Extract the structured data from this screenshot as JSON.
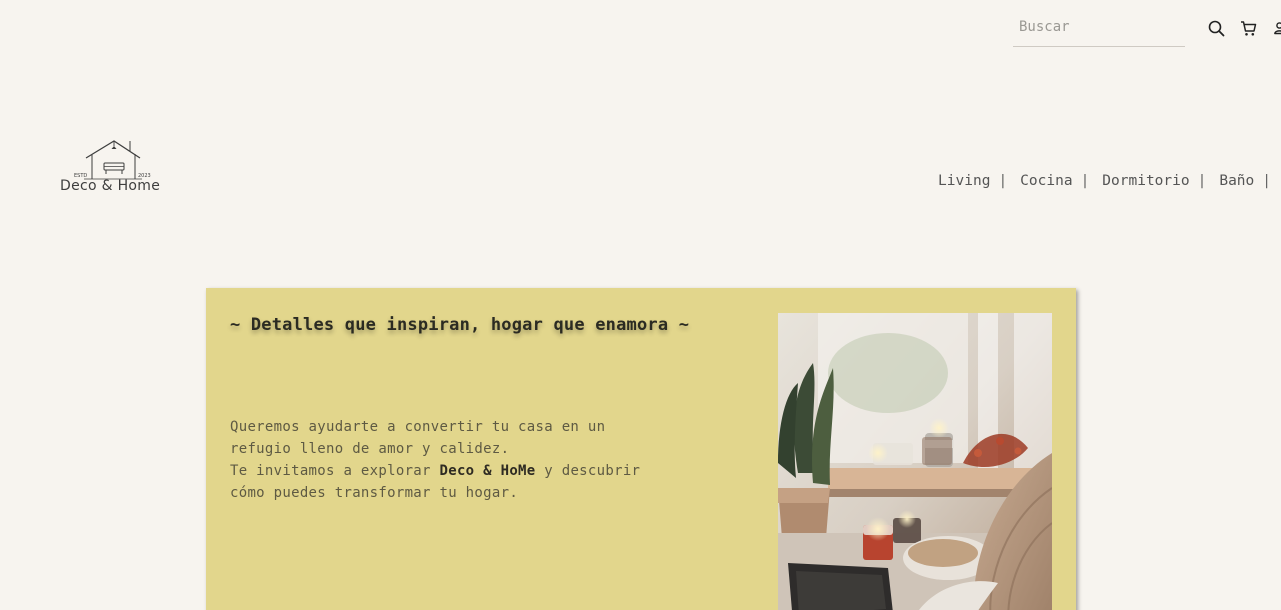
{
  "header": {
    "search": {
      "placeholder": "Buscar",
      "value": ""
    },
    "icons": [
      "search-icon",
      "cart-icon",
      "user-icon"
    ]
  },
  "logo": {
    "name": "Deco & Home",
    "est_left": "ESTD",
    "est_right": "2023"
  },
  "nav": {
    "items": [
      {
        "label": "Living",
        "sep": "|"
      },
      {
        "label": "Cocina",
        "sep": "|"
      },
      {
        "label": "Dormitorio",
        "sep": "|"
      },
      {
        "label": "Baño",
        "sep": "|"
      }
    ]
  },
  "hero": {
    "title": "~ Detalles que inspiran, hogar que enamora ~",
    "line1": "Queremos ayudarte a convertir tu casa en un",
    "line2": "refugio lleno de amor y calidez.",
    "line3_pre": "Te invitamos a explorar",
    "brand": "Deco & HoMe",
    "line3_post": "y descubrir",
    "line4": "cómo puedes transformar tu hogar."
  },
  "colors": {
    "background": "#f7f4ef",
    "hero_background": "#e2d68c",
    "text": "#444444"
  }
}
